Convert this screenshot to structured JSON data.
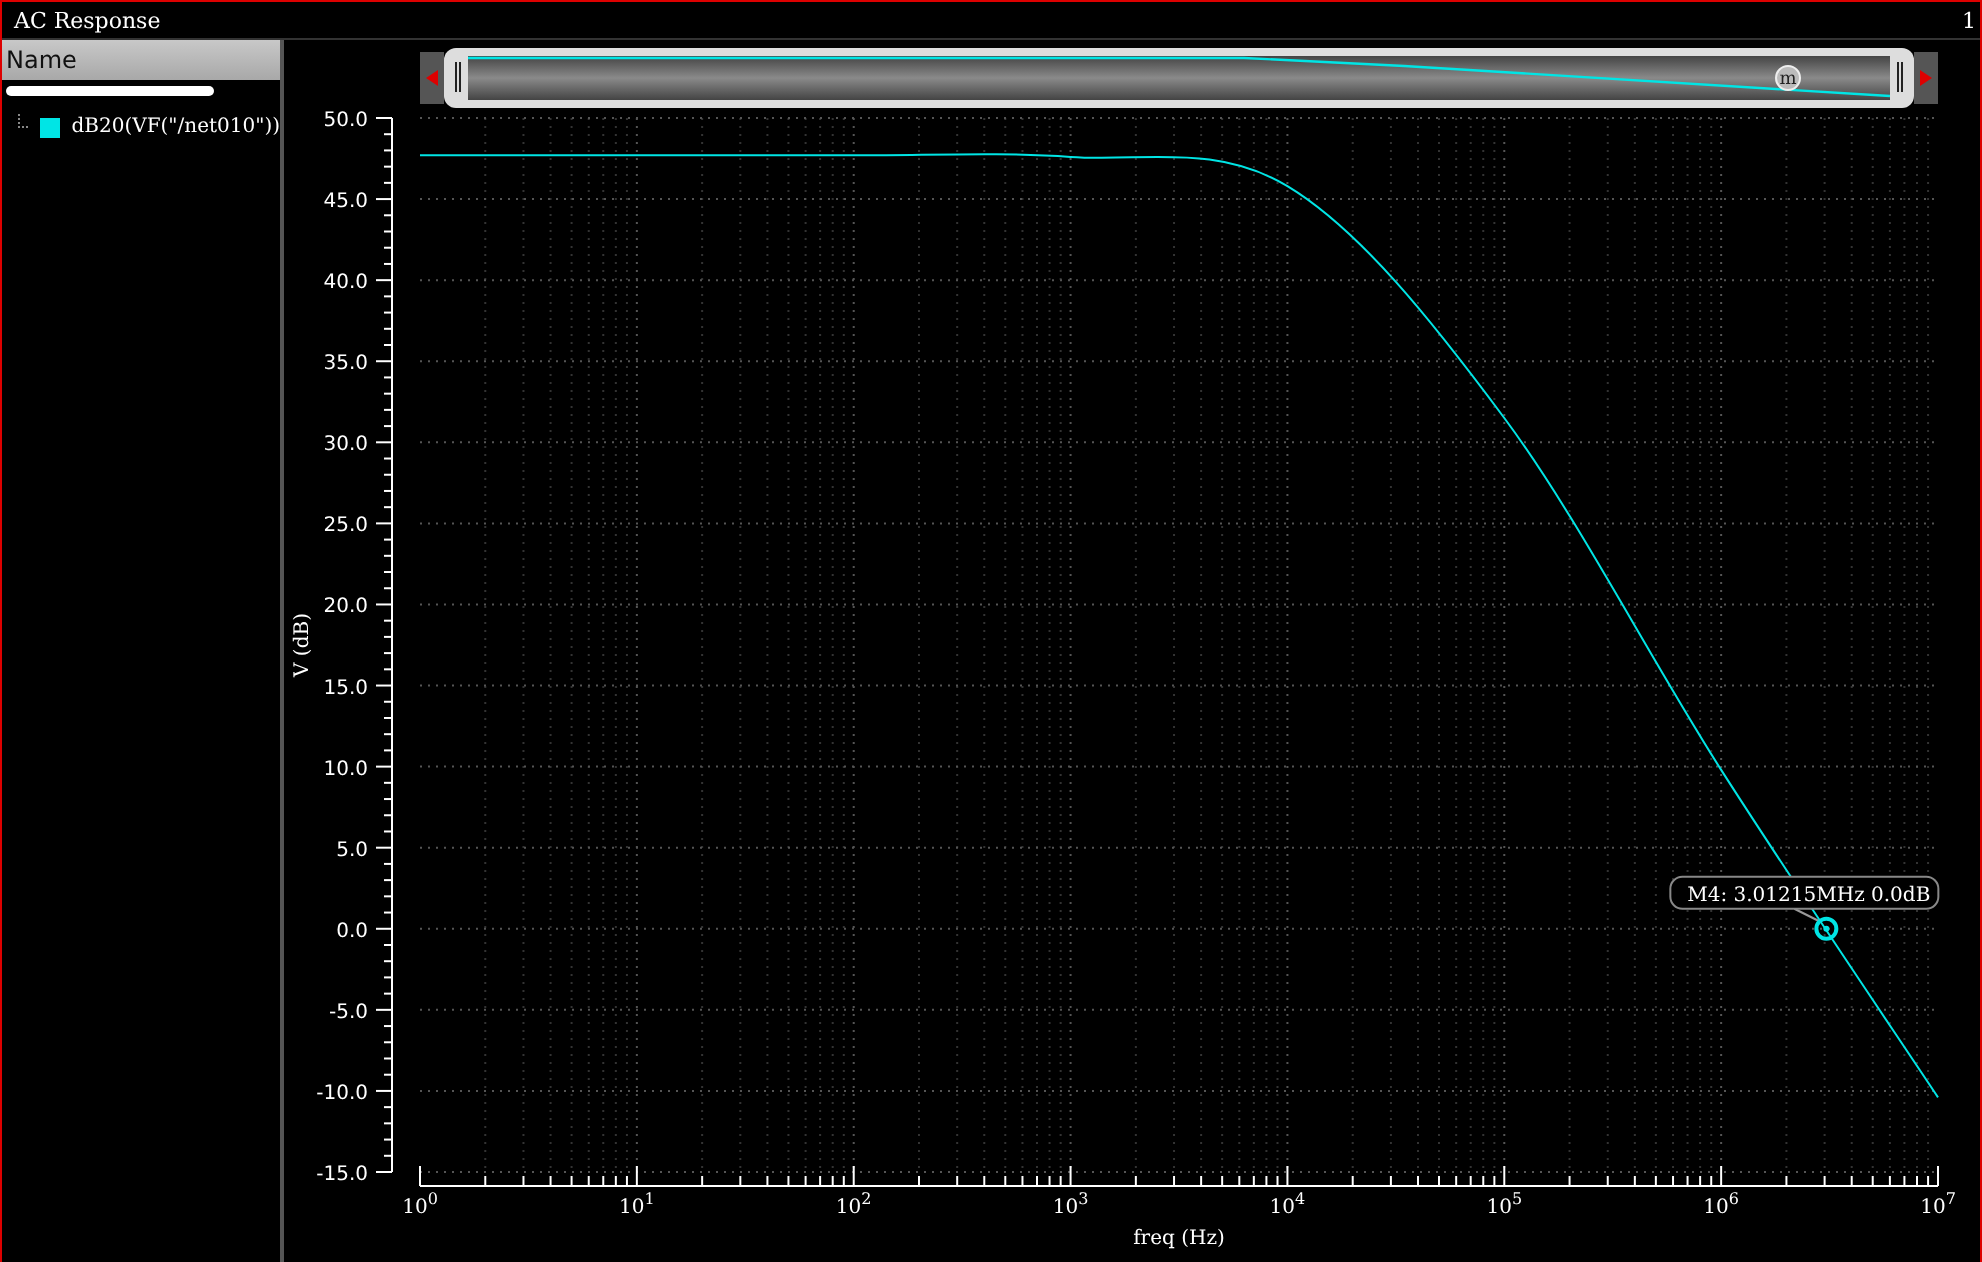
{
  "window": {
    "title": "AC Response",
    "corner_text": "1"
  },
  "legend": {
    "header": "Name"
  },
  "overview": {
    "marker_label": "m"
  },
  "plot": {
    "chart_data": {
      "type": "line",
      "grid": true,
      "xlabel": "freq (Hz)",
      "ylabel": "V (dB)",
      "ylim": [
        -15,
        50
      ],
      "categories": [
        "10$^{0}$",
        "10$^{1}$",
        "10$^{2}$",
        "10$^{3}$",
        "10$^{4}$",
        "10$^{5}$",
        "10$^{6}$",
        "10$^{7}$"
      ],
      "yticks": [
        {
          "value": 50,
          "label": "50.0"
        },
        {
          "value": 45,
          "label": "45.0"
        },
        {
          "value": 40,
          "label": "40.0"
        },
        {
          "value": 35,
          "label": "35.0"
        },
        {
          "value": 30,
          "label": "30.0"
        },
        {
          "value": 25,
          "label": "25.0"
        },
        {
          "value": 20,
          "label": "20.0"
        },
        {
          "value": 15,
          "label": "15.0"
        },
        {
          "value": 10,
          "label": "10.0"
        },
        {
          "value": 5,
          "label": "5.0"
        },
        {
          "value": 0,
          "label": "0.0"
        },
        {
          "value": -5,
          "label": "-5.0"
        },
        {
          "value": -10,
          "label": "-10.0"
        },
        {
          "value": -15,
          "label": "-15.0"
        }
      ],
      "series": [
        {
          "name": "dB20(VF(\"/net010\"))",
          "color": "#00e5e5",
          "values": [
            47.7,
            47.7,
            47.7,
            47.6,
            45.8,
            31.5,
            9.8,
            -10.4
          ]
        }
      ],
      "annotations": [
        "M4: 3.01215MHz 0.0dB"
      ]
    }
  }
}
